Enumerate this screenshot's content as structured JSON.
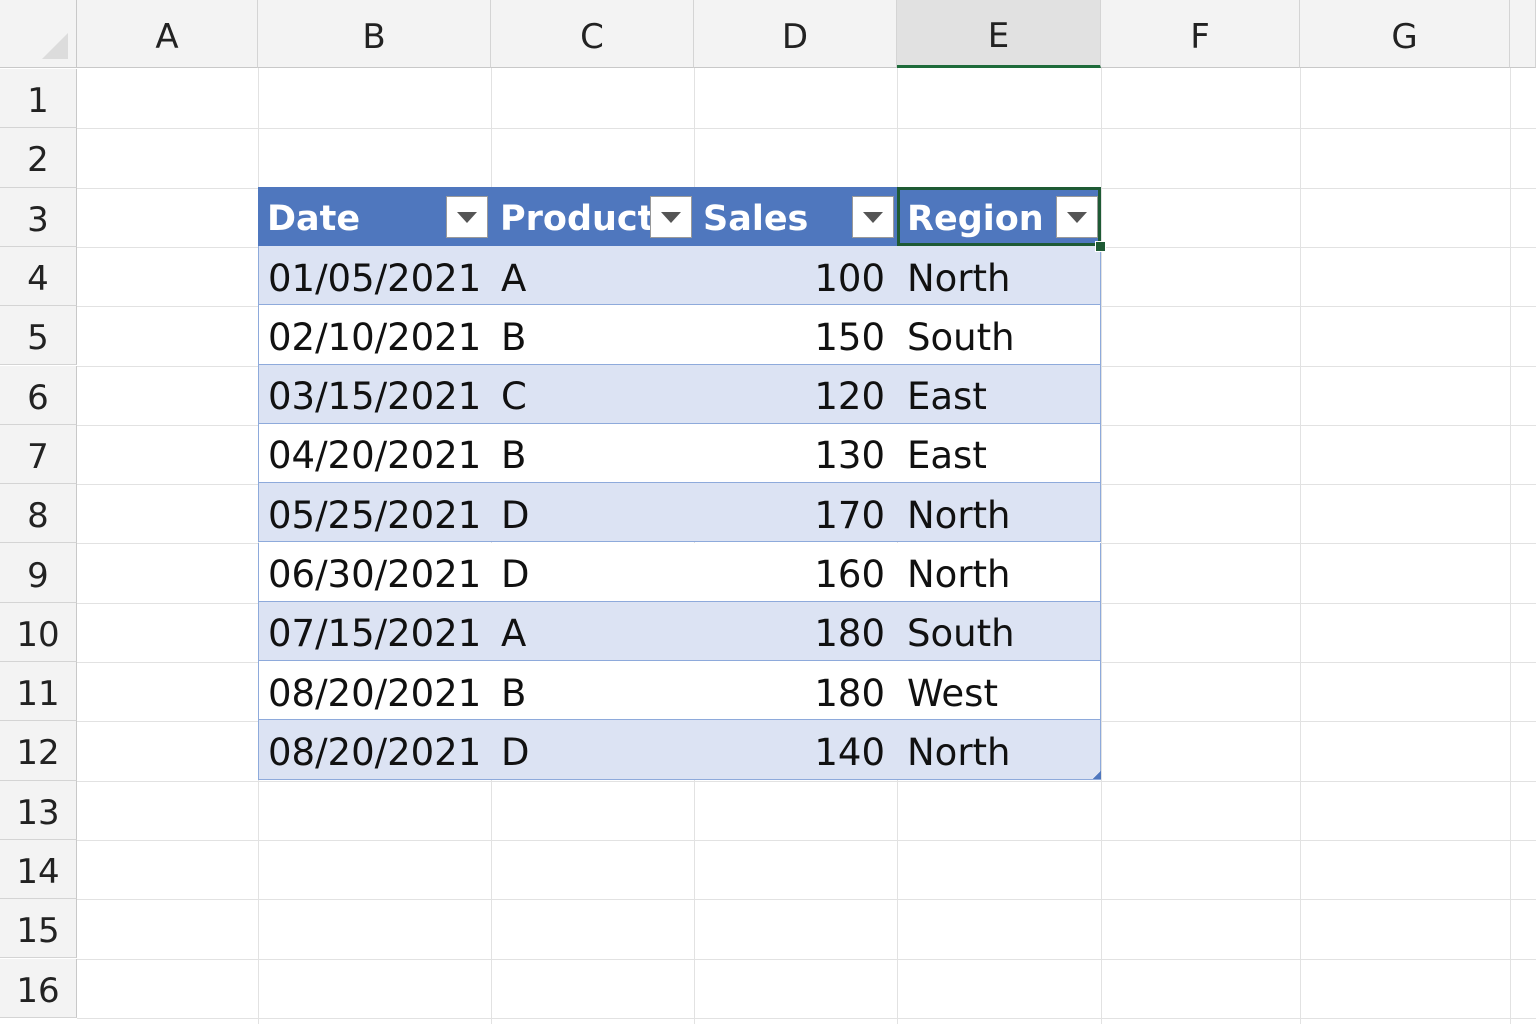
{
  "columns": [
    "A",
    "B",
    "C",
    "D",
    "E",
    "F",
    "G"
  ],
  "selected_column": "E",
  "rows": [
    "1",
    "2",
    "3",
    "4",
    "5",
    "6",
    "7",
    "8",
    "9",
    "10",
    "11",
    "12",
    "13",
    "14",
    "15",
    "16"
  ],
  "table": {
    "headers": [
      "Date",
      "Product",
      "Sales",
      "Region"
    ],
    "header_color": "#4f77be",
    "band_color": "#dce3f3",
    "active_header": "Region",
    "rows": [
      [
        "01/05/2021",
        "A",
        "100",
        "North"
      ],
      [
        "02/10/2021",
        "B",
        "150",
        "South"
      ],
      [
        "03/15/2021",
        "C",
        "120",
        "East"
      ],
      [
        "04/20/2021",
        "B",
        "130",
        "East"
      ],
      [
        "05/25/2021",
        "D",
        "170",
        "North"
      ],
      [
        "06/30/2021",
        "D",
        "160",
        "North"
      ],
      [
        "07/15/2021",
        "A",
        "180",
        "South"
      ],
      [
        "08/20/2021",
        "B",
        "180",
        "West"
      ],
      [
        "08/20/2021",
        "D",
        "140",
        "North"
      ]
    ]
  },
  "icons": {
    "filter_dropdown": "chevron-down-icon"
  }
}
